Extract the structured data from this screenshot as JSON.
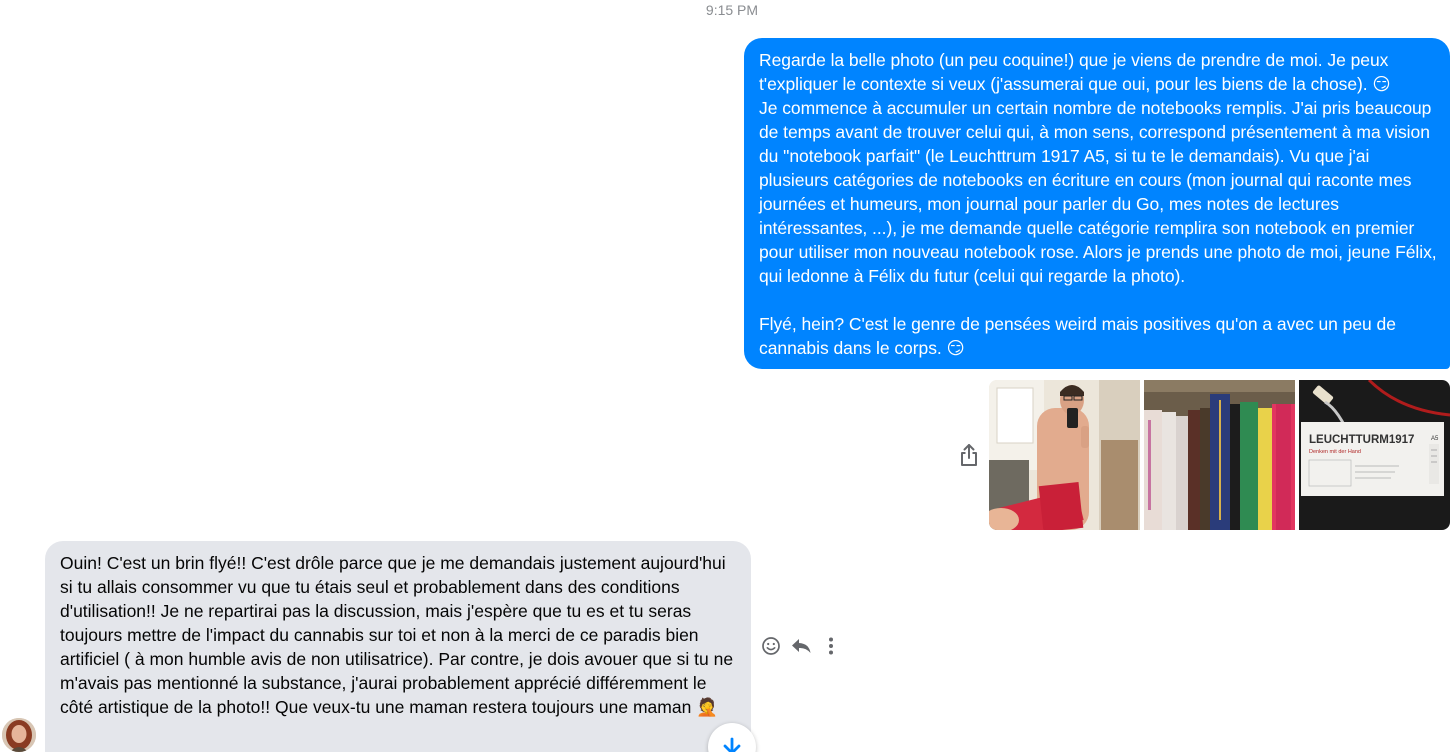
{
  "conversation": {
    "timestamp": "9:15 PM",
    "outgoing_message": "Regarde la belle photo (un peu coquine!) que je viens de prendre de moi. Je peux t'expliquer le contexte si veux (j'assumerai que oui, pour les biens de la chose). 😏\nJe commence à accumuler un certain nombre de notebooks remplis. J'ai pris beaucoup de temps avant de trouver celui qui, à mon sens, correspond présentement à ma vision du \"notebook parfait\" (le Leuchttrum 1917 A5, si tu te le demandais). Vu que j'ai plusieurs catégories de notebooks en écriture en cours (mon journal qui raconte mes journées et humeurs, mon journal pour parler du Go, mes notes de lectures intéressantes, ...), je me demande quelle catégorie remplira son notebook en premier pour utiliser mon nouveau notebook rose. Alors je prends une photo de moi, jeune Félix, qui ledonne à Félix du futur (celui qui regarde la photo).\n\nFlyé, hein? C'est le genre de pensées weird mais positives qu'on a avec un peu de cannabis dans le corps. 😏",
    "incoming_message": "Ouin! C'est un brin flyé!! C'est drôle parce que je me demandais justement aujourd'hui si tu allais consommer vu que tu étais seul et probablement dans des conditions d'utilisation!! Je ne repartirai pas la discussion, mais j'espère que tu es et tu seras toujours mettre de l'impact du cannabis sur toi et non à la merci de ce paradis bien artificiel ( à mon humble avis de non utilisatrice). Par contre, je dois avouer que si tu ne m'avais pas mentionné la substance, j'aurai probablement apprécié différemment le côté artistique de la photo!! Que veux-tu une maman restera toujours une maman 🤦",
    "notebook_cover_brand": "LEUCHTTURM1917",
    "notebook_cover_tagline": "Denken mit der Hand",
    "notebook_size_label": "A5"
  },
  "icons": {
    "share": "share-icon",
    "react": "smiley-icon",
    "reply": "reply-icon",
    "more": "more-vertical-icon",
    "scroll": "arrow-down-icon"
  },
  "colors": {
    "outgoing_bubble": "#0084ff",
    "incoming_bubble": "#e4e6eb",
    "timestamp": "#8a8d91",
    "icon_gray": "#65676b"
  }
}
